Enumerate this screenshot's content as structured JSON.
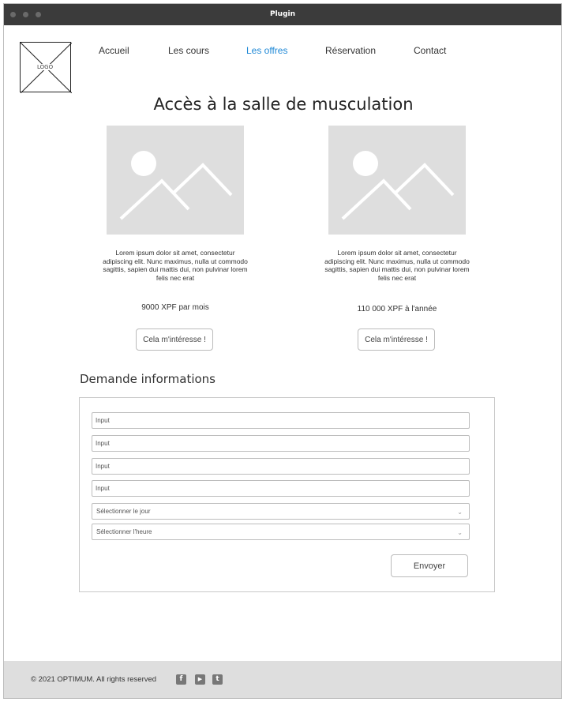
{
  "window": {
    "title": "Plugin"
  },
  "logo": {
    "text": "LOGO"
  },
  "nav": {
    "items": [
      {
        "label": "Accueil",
        "active": false
      },
      {
        "label": "Les cours",
        "active": false
      },
      {
        "label": "Les offres",
        "active": true
      },
      {
        "label": "Réservation",
        "active": false
      },
      {
        "label": "Contact",
        "active": false
      }
    ]
  },
  "main": {
    "title": "Accès à la salle de musculation",
    "offers": [
      {
        "image_icon": "image-placeholder-icon",
        "description": "Lorem ipsum dolor sit amet, consectetur adipiscing elit. Nunc maximus, nulla ut commodo sagittis, sapien dui mattis dui, non pulvinar lorem felis nec erat",
        "price": "9000 XPF par mois",
        "button_label": "Cela m'intéresse !"
      },
      {
        "image_icon": "image-placeholder-icon",
        "description": "Lorem ipsum dolor sit amet, consectetur adipiscing elit. Nunc maximus, nulla ut commodo sagittis, sapien dui mattis dui, non pulvinar lorem felis nec erat",
        "price": "110 000 XPF à l'année",
        "button_label": "Cela m'intéresse !"
      }
    ]
  },
  "form": {
    "title": "Demande informations",
    "inputs": [
      {
        "placeholder": "Input"
      },
      {
        "placeholder": "Input"
      },
      {
        "placeholder": "Input"
      },
      {
        "placeholder": "Input"
      }
    ],
    "selects": [
      {
        "value": "Sélectionner le jour"
      },
      {
        "value": "Sélectionner l'heure"
      }
    ],
    "submit_label": "Envoyer"
  },
  "footer": {
    "copyright": "© 2021 OPTIMUM. All rights reserved",
    "social": [
      {
        "icon": "facebook-icon",
        "glyph": "f"
      },
      {
        "icon": "youtube-icon",
        "glyph": "▶"
      },
      {
        "icon": "twitter-icon",
        "glyph": "t"
      }
    ]
  },
  "colors": {
    "accent": "#1e88d6",
    "titlebar": "#3b3b3b",
    "placeholder": "#dedede",
    "footer": "#dedede"
  }
}
